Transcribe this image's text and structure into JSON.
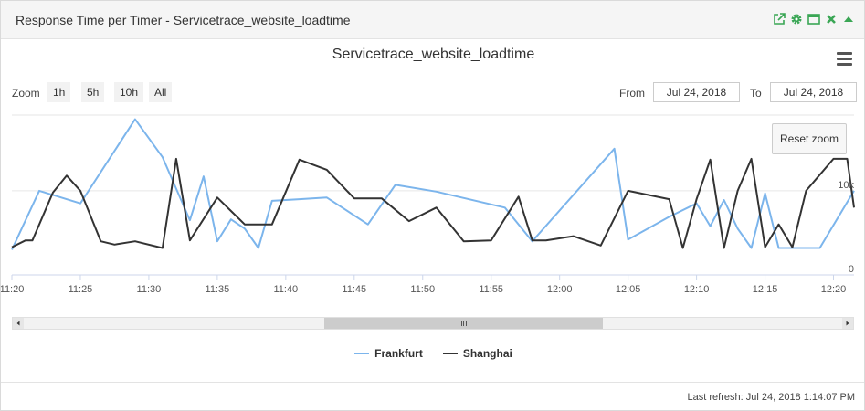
{
  "panel": {
    "title": "Response Time per Timer - Servicetrace_website_loadtime",
    "tools": [
      "external-link-icon",
      "gear-icon",
      "maximize-icon",
      "close-icon",
      "collapse-icon"
    ],
    "tool_color": "#3aa655"
  },
  "toolbar": {
    "zoom_label": "Zoom",
    "zoom_buttons": [
      "1h",
      "5h",
      "10h",
      "All"
    ],
    "from_label": "From",
    "from_value": "Jul 24, 2018",
    "to_label": "To",
    "to_value": "Jul 24, 2018",
    "reset_zoom": "Reset zoom"
  },
  "footer": {
    "last_refresh": "Last refresh: Jul 24, 2018 1:14:07 PM"
  },
  "chart_data": {
    "type": "line",
    "title": "Servicetrace_website_loadtime",
    "xlabel": "",
    "ylabel": "",
    "x_ticks": [
      "11:20",
      "11:25",
      "11:30",
      "11:35",
      "11:40",
      "11:45",
      "11:50",
      "11:55",
      "12:00",
      "12:05",
      "12:10",
      "12:15",
      "12:20"
    ],
    "y_ticks": [
      "0",
      "10k"
    ],
    "ylim": [
      0,
      19000
    ],
    "xlim_minutes": [
      0,
      61.5
    ],
    "grid": true,
    "legend_position": "bottom-center",
    "series": [
      {
        "name": "Frankfurt",
        "color": "#7cb5ec",
        "x": [
          0,
          2,
          5,
          9,
          11,
          13,
          14,
          15,
          16,
          17,
          18,
          19,
          21,
          23,
          26,
          28,
          31,
          36,
          38,
          44,
          45,
          48,
          50,
          51,
          52,
          53,
          54,
          55,
          56,
          57,
          59,
          61.5
        ],
        "y": [
          3000,
          10000,
          8500,
          18500,
          14000,
          6500,
          11700,
          4000,
          6600,
          5500,
          3200,
          8800,
          9000,
          9200,
          6000,
          10700,
          9900,
          8000,
          4000,
          15000,
          4200,
          6900,
          8500,
          5800,
          8900,
          5500,
          3200,
          9700,
          3200,
          3200,
          3200,
          10000
        ]
      },
      {
        "name": "Shanghai",
        "color": "#333333",
        "x": [
          0,
          1,
          1.5,
          3,
          4,
          5,
          6.5,
          7.5,
          9,
          11,
          12,
          13,
          15,
          17,
          19,
          21,
          23,
          25,
          27,
          29,
          31,
          33,
          35,
          37,
          38,
          39,
          41,
          43,
          45,
          48,
          49,
          50,
          51,
          52,
          53,
          54,
          55,
          56,
          57,
          58,
          60,
          61,
          61.5
        ],
        "y": [
          3300,
          4100,
          4100,
          9800,
          11800,
          10000,
          4000,
          3600,
          4000,
          3200,
          13800,
          4100,
          9200,
          6000,
          6000,
          13700,
          12500,
          9100,
          9100,
          6400,
          8000,
          4000,
          4100,
          9300,
          4100,
          4100,
          4600,
          3500,
          10000,
          9000,
          3200,
          9000,
          13700,
          3200,
          10000,
          13800,
          3300,
          6000,
          3300,
          10000,
          13800,
          13800,
          8000
        ]
      }
    ]
  }
}
